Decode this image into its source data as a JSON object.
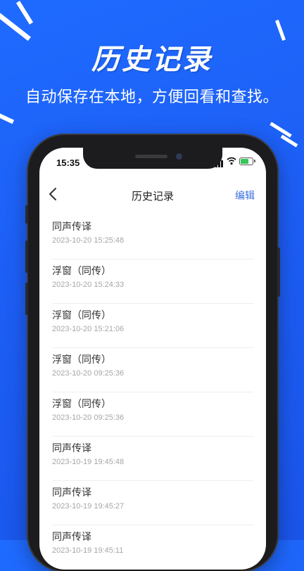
{
  "promo": {
    "headline": "历史记录",
    "subline": "自动保存在本地，方便回看和查找。"
  },
  "status_bar": {
    "time": "15:35",
    "icons": [
      "signal-icon",
      "wifi-icon",
      "battery-charging-icon"
    ]
  },
  "navbar": {
    "title": "历史记录",
    "edit_label": "编辑",
    "back_icon": "chevron-left-icon"
  },
  "records": [
    {
      "title": "同声传译",
      "time": "2023-10-20 15:25:48"
    },
    {
      "title": "浮窗（同传）",
      "time": "2023-10-20 15:24:33"
    },
    {
      "title": "浮窗（同传）",
      "time": "2023-10-20 15:21:06"
    },
    {
      "title": "浮窗（同传）",
      "time": "2023-10-20 09:25:36"
    },
    {
      "title": "浮窗（同传）",
      "time": "2023-10-20 09:25:36"
    },
    {
      "title": "同声传译",
      "time": "2023-10-19 19:45:48"
    },
    {
      "title": "同声传译",
      "time": "2023-10-19 19:45:27"
    },
    {
      "title": "同声传译",
      "time": "2023-10-19 19:45:11"
    }
  ],
  "colors": {
    "background": "#1f6bff",
    "accent": "#3a6fe0",
    "secondary_text": "#a6a6a6"
  }
}
